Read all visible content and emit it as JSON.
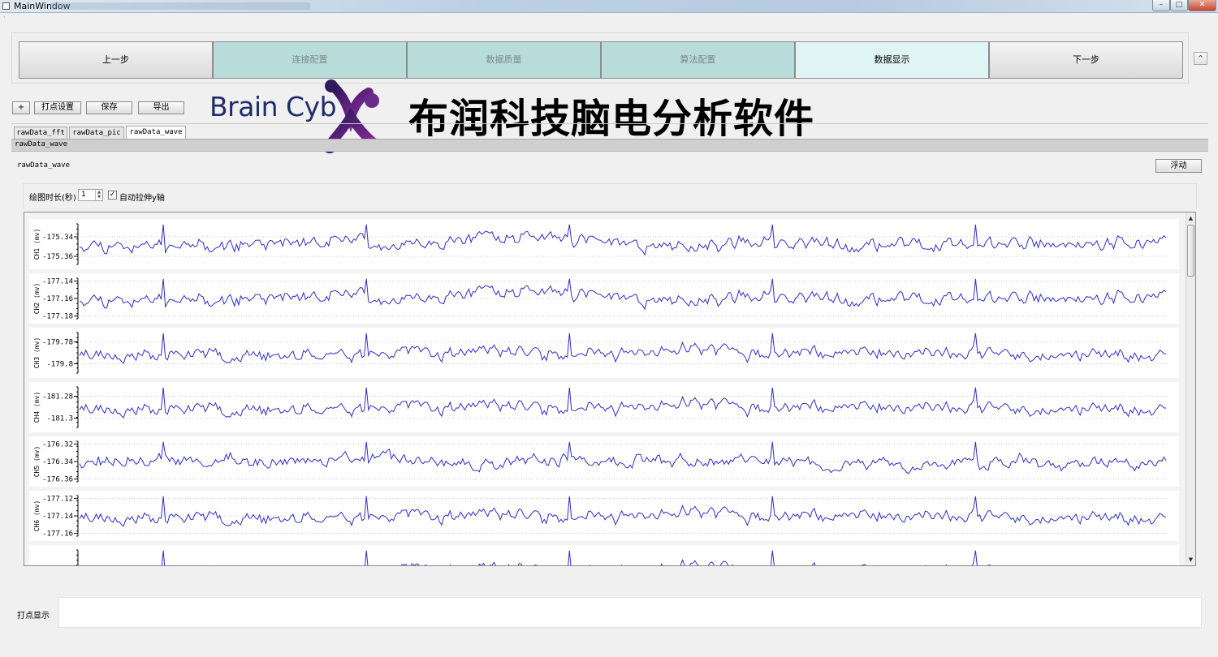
{
  "window": {
    "title": "MainWindow",
    "controls": [
      "–",
      "□",
      "✕"
    ]
  },
  "steps": [
    {
      "label": "上一步",
      "kind": "nav"
    },
    {
      "label": "连接配置",
      "kind": "cfg"
    },
    {
      "label": "数据质量",
      "kind": "cfg"
    },
    {
      "label": "算法配置",
      "kind": "cfg"
    },
    {
      "label": "数据显示",
      "kind": "active"
    },
    {
      "label": "下一步",
      "kind": "nav"
    }
  ],
  "side_button": "^",
  "toolbar": {
    "plus": "+",
    "mark": "打点设置",
    "save": "保存",
    "export": "导出"
  },
  "brand": {
    "logo_text": "Brain Cyb",
    "title": "布润科技脑电分析软件",
    "accent_colors": [
      "#1f2d6b",
      "#7a2a8c",
      "#2f1a5a"
    ]
  },
  "tabs": [
    {
      "label": "rawData_fft"
    },
    {
      "label": "rawData_pic"
    },
    {
      "label": "rawData_wave",
      "active": true
    }
  ],
  "tab_strip_label": "rawData_wave",
  "pane_label": "rawData_wave",
  "float_button": "浮动",
  "settings": {
    "duration_label": "绘图时长(秒)",
    "duration_value": "1",
    "auto_y_label": "自动拉伸y轴",
    "auto_y_checked": true
  },
  "chart_data": [
    {
      "type": "line",
      "ylabel": "CH1 (mv)",
      "yticks": [
        "-175.34",
        "-175.36"
      ],
      "ylim": [
        -175.37,
        -175.325
      ],
      "color": "#2e2ec8",
      "seed": 11
    },
    {
      "type": "line",
      "ylabel": "CH2 (mv)",
      "yticks": [
        "-177.14",
        "-177.16",
        "-177.18"
      ],
      "ylim": [
        -177.185,
        -177.135
      ],
      "color": "#2e2ec8",
      "seed": 11
    },
    {
      "type": "line",
      "ylabel": "CH3 (mv)",
      "yticks": [
        "-179.78",
        "-179.8"
      ],
      "ylim": [
        -179.81,
        -179.77
      ],
      "color": "#2e2ec8",
      "seed": 23
    },
    {
      "type": "line",
      "ylabel": "CH4 (mv)",
      "yticks": [
        "-181.28",
        "-181.3"
      ],
      "ylim": [
        -181.31,
        -181.27
      ],
      "color": "#2e2ec8",
      "seed": 23
    },
    {
      "type": "line",
      "ylabel": "CH5 (mv)",
      "yticks": [
        "-176.32",
        "-176.34",
        "-176.36"
      ],
      "ylim": [
        -176.365,
        -176.315
      ],
      "color": "#2e2ec8",
      "seed": 37
    },
    {
      "type": "line",
      "ylabel": "CH6 (mv)",
      "yticks": [
        "-177.12",
        "-177.14",
        "-177.16"
      ],
      "ylim": [
        -177.165,
        -177.115
      ],
      "color": "#2e2ec8",
      "seed": 23
    },
    {
      "type": "line",
      "ylabel": "v)",
      "yticks": [],
      "ylim": [
        -1,
        1
      ],
      "color": "#2e2ec8",
      "seed": 23
    }
  ],
  "bottom": {
    "dot_label": "打点显示"
  }
}
